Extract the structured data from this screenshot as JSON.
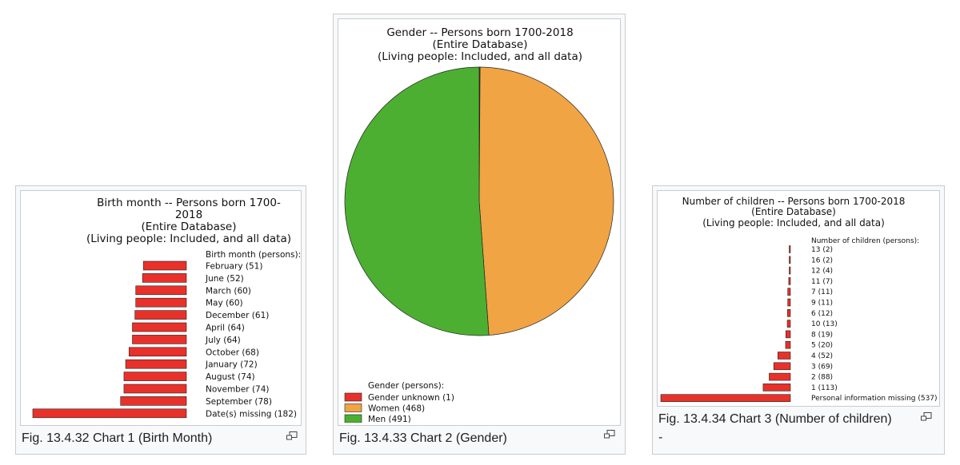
{
  "figures": [
    {
      "caption": "Fig. 13.4.32 Chart 1 (Birth Month)",
      "caption_extra": "",
      "chart_data": {
        "type": "bar",
        "orientation": "horizontal",
        "title": "Birth month -- Persons born 1700-2018",
        "subtitle": "(Entire Database)",
        "subtitle2": "(Living people: Included, and all data)",
        "legend_title": "Birth month (persons):",
        "categories": [
          "February (51)",
          "June (52)",
          "March (60)",
          "May (60)",
          "December (61)",
          "April (64)",
          "July (64)",
          "October (68)",
          "January (72)",
          "August (74)",
          "November (74)",
          "September (78)",
          "Date(s) missing (182)"
        ],
        "values": [
          51,
          52,
          60,
          60,
          61,
          64,
          64,
          68,
          72,
          74,
          74,
          78,
          182
        ],
        "bar_color": "#e8312a"
      }
    },
    {
      "caption": "Fig. 13.4.33 Chart 2 (Gender)",
      "caption_extra": "",
      "chart_data": {
        "type": "pie",
        "title": "Gender -- Persons born 1700-2018",
        "subtitle": "(Entire Database)",
        "subtitle2": "(Living people: Included, and all data)",
        "legend_title": "Gender (persons):",
        "categories": [
          "Gender unknown (1)",
          "Women (468)",
          "Men (491)"
        ],
        "values": [
          1,
          468,
          491
        ],
        "colors": [
          "#e8312a",
          "#f0a444",
          "#4caf32"
        ]
      }
    },
    {
      "caption": "Fig. 13.4.34 Chart 3 (Number of children)",
      "caption_extra": "-",
      "chart_data": {
        "type": "bar",
        "orientation": "horizontal",
        "title": "Number of children -- Persons born 1700-2018",
        "subtitle": "(Entire Database)",
        "subtitle2": "(Living people: Included, and all data)",
        "legend_title": "Number of children (persons):",
        "categories": [
          "13 (2)",
          "16 (2)",
          "12 (4)",
          "11 (7)",
          "7 (11)",
          "9 (11)",
          "6 (12)",
          "10 (13)",
          "8 (19)",
          "5 (20)",
          "4 (52)",
          "3 (69)",
          "2 (88)",
          "1 (113)",
          "Personal information missing (537)"
        ],
        "values": [
          2,
          2,
          4,
          7,
          11,
          11,
          12,
          13,
          19,
          20,
          52,
          69,
          88,
          113,
          537
        ],
        "bar_color": "#e8312a"
      }
    }
  ]
}
